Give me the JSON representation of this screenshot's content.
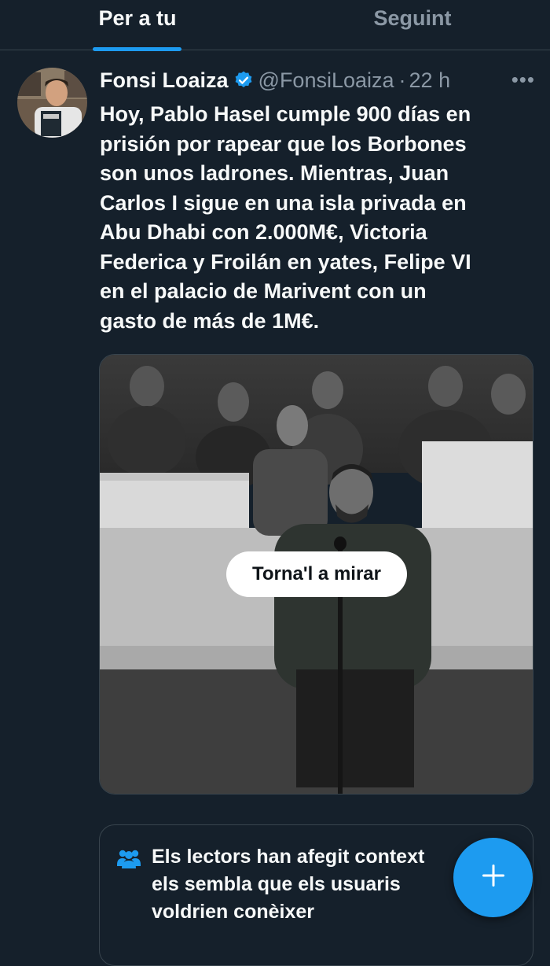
{
  "tabs": [
    {
      "label": "Per a tu",
      "active": true
    },
    {
      "label": "Seguint",
      "active": false
    }
  ],
  "tweet": {
    "author_name": "Fonsi Loaiza",
    "handle": "@FonsiLoaiza",
    "separator": "·",
    "time": "22 h",
    "more": "•••",
    "verified": true,
    "text_lines": [
      "Hoy, Pablo Hasel cumple 900 días en",
      "prisión por rapear que los Borbones",
      "son unos ladrones. Mientras, Juan",
      "Carlos I sigue en una isla privada en",
      "Abu Dhabi con 2.000M€, Victoria",
      "Federica y Froilán en yates, Felipe VI",
      "en el palacio de Marivent con un",
      "gasto de más de 1M€."
    ],
    "media": {
      "replay_label": "Torna'l a mirar"
    }
  },
  "community_note": {
    "icon": "people-icon",
    "lines": [
      "Els lectors han afegit context",
      "els sembla que els usuaris",
      "voldrien conèixer"
    ]
  },
  "fab": {
    "icon": "plus-icon"
  },
  "colors": {
    "background": "#15202b",
    "accent": "#1d9bf0",
    "muted": "#8b98a5",
    "border": "#38444d"
  }
}
